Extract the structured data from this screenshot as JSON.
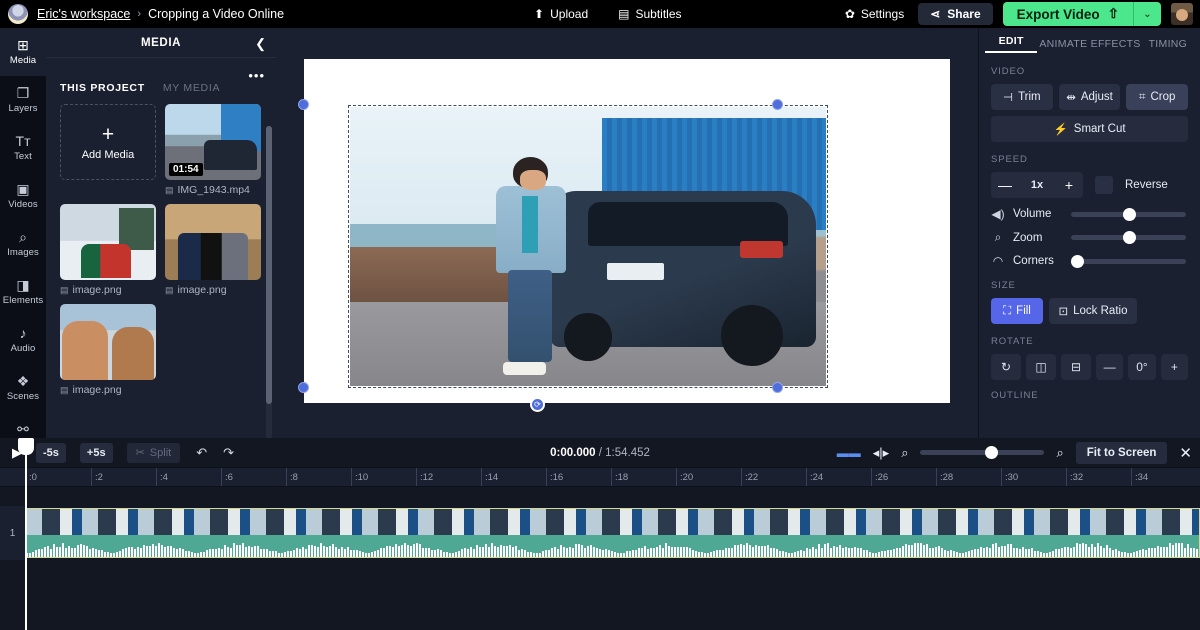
{
  "topbar": {
    "workspace": "Eric's workspace",
    "separator": "›",
    "project_title": "Cropping a Video Online",
    "upload_label": "Upload",
    "subtitles_label": "Subtitles",
    "settings_label": "Settings",
    "share_label": "Share",
    "export_label": "Export Video",
    "export_caret": "⌄",
    "accent_green": "#4ce68c"
  },
  "rail": {
    "items": [
      {
        "label": "Media",
        "icon": "media-add-icon",
        "glyph": "⊞",
        "active": true
      },
      {
        "label": "Layers",
        "icon": "layers-icon",
        "glyph": "❐",
        "active": false
      },
      {
        "label": "Text",
        "icon": "text-icon",
        "glyph": "Tт",
        "active": false
      },
      {
        "label": "Videos",
        "icon": "video-icon",
        "glyph": "▣",
        "active": false
      },
      {
        "label": "Images",
        "icon": "search-image-icon",
        "glyph": "🔍",
        "active": false
      },
      {
        "label": "Elements",
        "icon": "elements-icon",
        "glyph": "◨",
        "active": false
      },
      {
        "label": "Audio",
        "icon": "music-note-icon",
        "glyph": "♪",
        "active": false
      },
      {
        "label": "Scenes",
        "icon": "scenes-stack-icon",
        "glyph": "◈",
        "active": false
      },
      {
        "label": "Plugins",
        "icon": "plug-icon",
        "glyph": "⚯",
        "active": false
      }
    ]
  },
  "media_panel": {
    "title": "MEDIA",
    "collapse_icon": "chevron-left-icon",
    "more_icon": "more-dots-icon",
    "tabs": [
      {
        "label": "THIS PROJECT",
        "active": true
      },
      {
        "label": "MY MEDIA",
        "active": false
      }
    ],
    "add_media_label": "Add Media",
    "add_media_plus": "+",
    "items": [
      {
        "name": "IMG_1943.mp4",
        "duration": "01:54",
        "type": "video"
      },
      {
        "name": "image.png",
        "duration": "",
        "type": "image"
      },
      {
        "name": "image.png",
        "duration": "",
        "type": "image"
      },
      {
        "name": "image.png",
        "duration": "",
        "type": "image"
      }
    ]
  },
  "right_panel": {
    "tabs": [
      {
        "label": "EDIT",
        "active": true
      },
      {
        "label": "ANIMATE",
        "active": false
      },
      {
        "label": "EFFECTS",
        "active": false
      },
      {
        "label": "TIMING",
        "active": false
      }
    ],
    "video_section": "VIDEO",
    "trim_label": "Trim",
    "adjust_label": "Adjust",
    "crop_label": "Crop",
    "smart_cut_label": "Smart Cut",
    "speed_section": "SPEED",
    "speed_value": "1x",
    "speed_minus": "—",
    "speed_plus": "+",
    "reverse_label": "Reverse",
    "volume_label": "Volume",
    "volume_pct": 50,
    "zoom_label": "Zoom",
    "zoom_pct": 50,
    "corners_label": "Corners",
    "corners_pct": 0,
    "size_section": "SIZE",
    "fill_label": "Fill",
    "lock_ratio_label": "Lock Ratio",
    "rotate_section": "ROTATE",
    "rotate_value": "0°",
    "rotate_minus": "—",
    "rotate_plus": "+",
    "outline_section": "OUTLINE",
    "accent_blue": "#5566e8"
  },
  "timeline": {
    "play_icon": "play-icon",
    "back5_label": "-5s",
    "fwd5_label": "+5s",
    "split_label": "Split",
    "undo_icon": "undo-icon",
    "redo_icon": "redo-icon",
    "current_time": "0:00.000",
    "time_separator": "/",
    "total_time": "1:54.452",
    "fit_label": "Fit to Screen",
    "close_icon": "close-icon",
    "zoom_pct": 55,
    "ruler_ticks": [
      ":0",
      ":2",
      ":4",
      ":6",
      ":8",
      ":10",
      ":12",
      ":14",
      ":16",
      ":18",
      ":20",
      ":22",
      ":24",
      ":26",
      ":28",
      ":30",
      ":32",
      ":34"
    ],
    "track_number": "1"
  }
}
